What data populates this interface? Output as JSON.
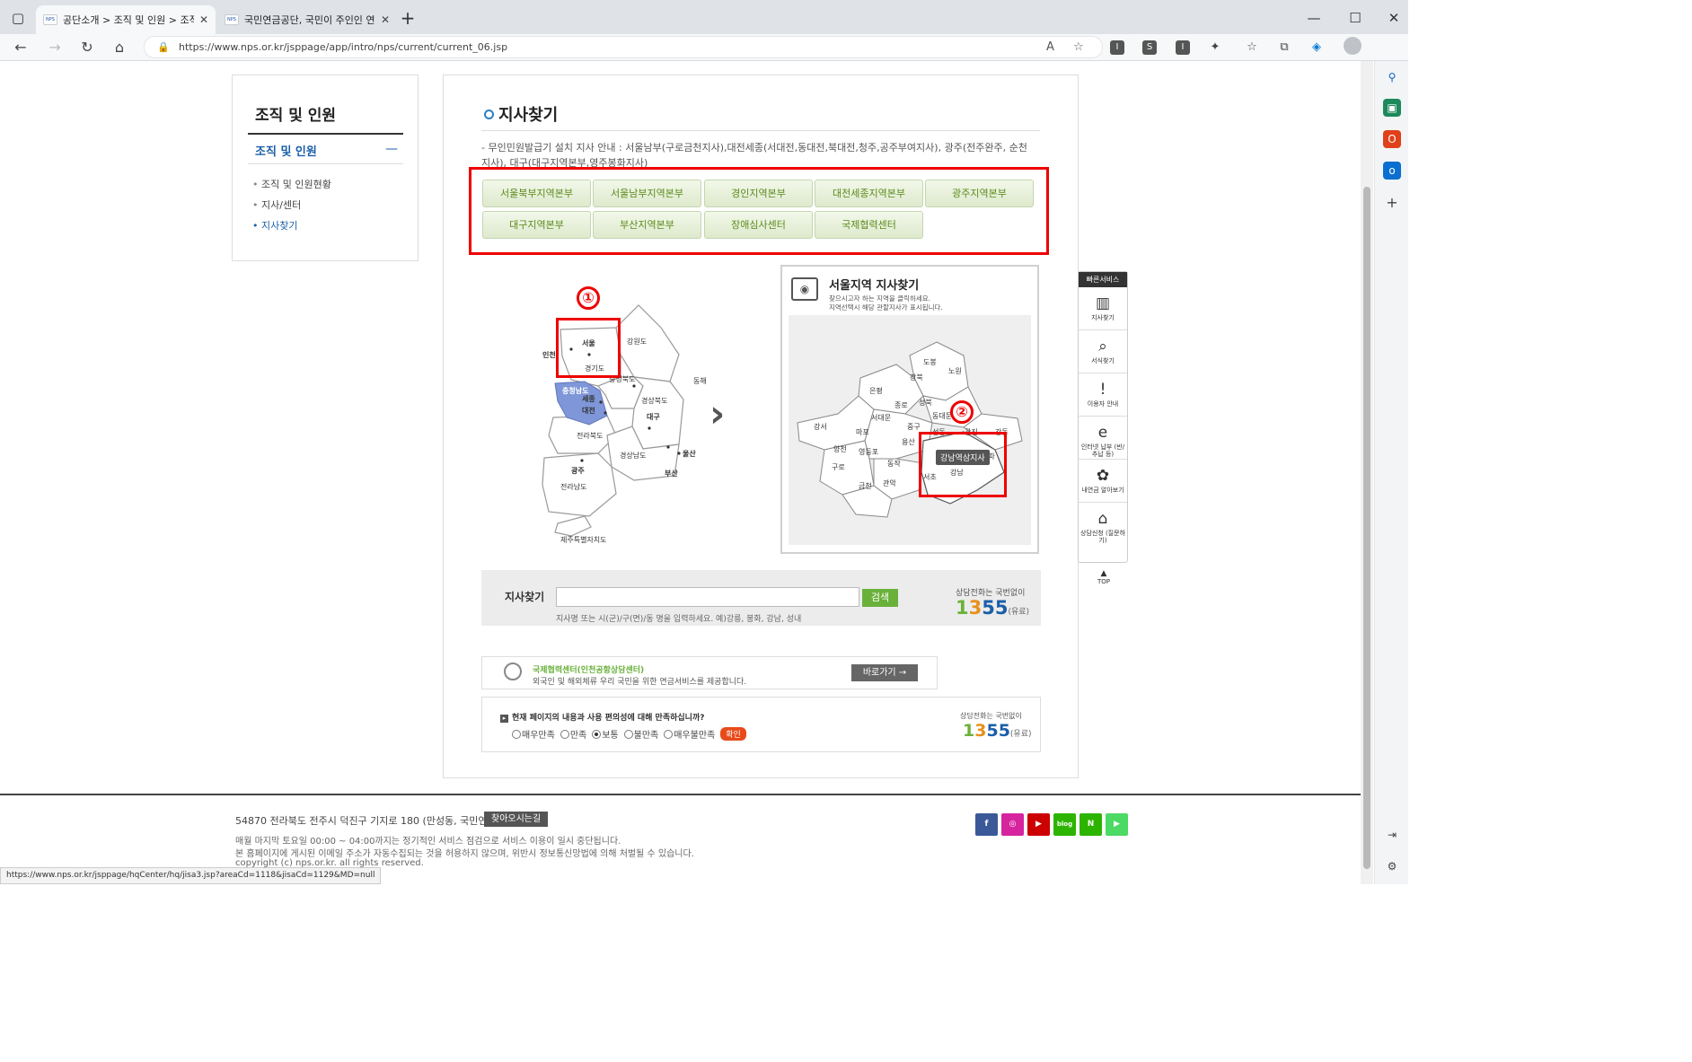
{
  "browser": {
    "tabs": [
      {
        "favicon": "NPS",
        "title": "공단소개 > 조직 및 인원 > 조직",
        "active": true
      },
      {
        "favicon": "NPS",
        "title": "국민연금공단, 국민이 주인인 연",
        "active": false
      }
    ],
    "new_tab": "+",
    "url": "https://www.nps.or.kr/jsppage/app/intro/nps/current/current_06.jsp",
    "status_url": "https://www.nps.or.kr/jsppage/hqCenter/hq/jisa3.jsp?areaCd=1118&jisaCd=1129&MD=null",
    "window_controls": {
      "minimize": "—",
      "maximize": "☐",
      "close": "✕"
    }
  },
  "lnb": {
    "title": "조직 및 인원",
    "section": "조직 및 인원",
    "items": [
      "조직 및 인원현황",
      "지사/센터",
      "지사찾기"
    ]
  },
  "content": {
    "title": "지사찾기",
    "notice": "- 무인민원발급기 설치 지사 안내 : 서울남부(구로금천지사),대전세종(서대전,동대전,북대전,청주,공주부여지사), 광주(전주완주, 순천지사), 대구(대구지역본부,영주봉화지사)",
    "regions": [
      "서울북부지역본부",
      "서울남부지역본부",
      "경인지역본부",
      "대전세종지역본부",
      "광주지역본부",
      "대구지역본부",
      "부산지역본부",
      "장애심사센터",
      "국제협력센터"
    ]
  },
  "korea_map": {
    "badge": "①",
    "labels": [
      "서울",
      "인천",
      "경기도",
      "강원도",
      "충청북도",
      "충청남도",
      "세종",
      "대전",
      "경상북도",
      "대구",
      "동해",
      "전라북도",
      "울산",
      "경상남도",
      "광주",
      "부산",
      "전라남도",
      "제주특별자치도"
    ]
  },
  "seoul_panel": {
    "title": "서울지역 지사찾기",
    "desc1": "찾으시고자 하는 지역을 클릭하세요.",
    "desc2": "지역선택시 해당 관할지사가 표시됩니다.",
    "badge": "②",
    "districts": [
      "도봉",
      "노원",
      "강북",
      "은평",
      "성북",
      "종로",
      "동대문",
      "서대문",
      "중구",
      "중랑",
      "강서",
      "마포",
      "광진",
      "용산",
      "성동",
      "양천",
      "영등포",
      "구로",
      "동작",
      "강동",
      "금천",
      "관악",
      "서초",
      "강남",
      "송파"
    ],
    "tooltip": "강남역삼지사",
    "highlight": "강남역삼"
  },
  "search": {
    "label": "지사찾기",
    "value": "",
    "button": "검색",
    "hint": "지사명 또는 시(군)/구(면)/동 명을 입력하세요. 예)강릉, 봉화, 강남, 성내",
    "call_label": "상담전화는 국번없이",
    "call_d1": "1",
    "call_d2": "3",
    "call_d3": "55",
    "call_paid": "(유료)"
  },
  "intl": {
    "title": "국제협력센터(인천공항상담센터)",
    "desc": "외국인 및 해외체류 우리 국민을 위한 연금서비스를 제공합니다.",
    "button": "바로가기 →"
  },
  "survey": {
    "question": "현재 페이지의 내용과 사용 편의성에 대해 만족하십니까?",
    "options": [
      "매우만족",
      "만족",
      "보통",
      "불만족",
      "매우불만족"
    ],
    "selected": "보통",
    "confirm": "확인",
    "call_label": "상담전화는 국번없이",
    "call_d1": "1",
    "call_d2": "3",
    "call_d3": "55",
    "call_paid": "(유료)"
  },
  "quick_menu": {
    "header": "빠른서비스",
    "items": [
      {
        "label": "지사찾기",
        "icon": "building-icon"
      },
      {
        "label": "서식찾기",
        "icon": "document-search-icon"
      },
      {
        "label": "이용자 안내",
        "icon": "info-bubble-icon"
      },
      {
        "label": "인터넷 납부 (반/추납 등)",
        "icon": "e-payment-icon"
      },
      {
        "label": "내연금 알아보기",
        "icon": "clover-icon"
      },
      {
        "label": "상담신청 (질문하기)",
        "icon": "mouse-icon"
      }
    ],
    "top": "TOP"
  },
  "footer": {
    "address": "54870 전라북도 전주시 덕진구 기지로 180 (만성동, 국민연금)",
    "directions": "찾아오시는길",
    "line1": "매월 마지막 토요일 00:00 ~ 04:00까지는 정기적인 서비스 점검으로 서비스 이용이 일시 중단됩니다.",
    "line2": "본 홈페이지에 게시된 이메일 주소가 자동수집되는 것을 허용하지 않으며, 위반시 정보통신망법에 의해 처벌될 수 있습니다.",
    "line3": "copyright (c) nps.or.kr. all rights reserved.",
    "sns": [
      {
        "name": "facebook",
        "glyph": "f",
        "color": "#3b5998"
      },
      {
        "name": "instagram",
        "glyph": "◎",
        "color": "#d6249f"
      },
      {
        "name": "youtube",
        "glyph": "▶",
        "color": "#cc0000"
      },
      {
        "name": "blog",
        "glyph": "blog",
        "color": "#2db400"
      },
      {
        "name": "naver-post",
        "glyph": "N",
        "color": "#2db400"
      },
      {
        "name": "naver-tv",
        "glyph": "▶",
        "color": "#4cd964"
      }
    ]
  }
}
